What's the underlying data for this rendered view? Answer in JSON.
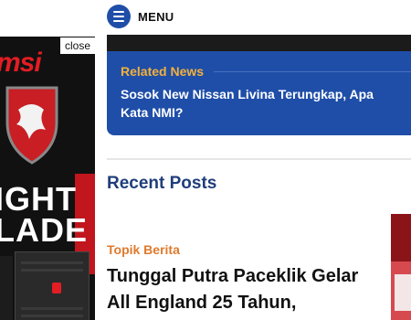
{
  "header": {
    "menu_label": "MENU"
  },
  "related": {
    "label": "Related News",
    "title": "Sosok New Nissan Livina Terungkap, Apa Kata NMI?"
  },
  "recent": {
    "heading": "Recent Posts",
    "posts": [
      {
        "topic": "Topik Berita",
        "title": "Tunggal Putra Paceklik Gelar All England 25 Tahun,"
      }
    ]
  },
  "ad": {
    "close_label": "close",
    "brand": "msi",
    "line1": "IGHT",
    "line2": "LADE"
  },
  "colors": {
    "accent_blue": "#1f4ea8",
    "heading_blue": "#1f3d7a",
    "related_label": "#f3b13b",
    "topic_orange": "#e07a2c",
    "brand_red": "#e31d24"
  }
}
